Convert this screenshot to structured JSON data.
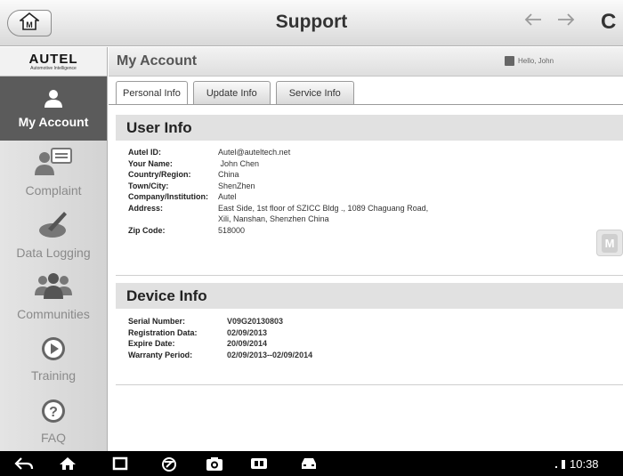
{
  "topbar": {
    "title": "Support",
    "home_icon": "home-icon",
    "back_icon": "arrow-left-icon",
    "forward_icon": "arrow-right-icon",
    "refresh_label": "C"
  },
  "sidebar": {
    "logo_main": "AUTEL",
    "logo_sub": "Automotive Intelligence",
    "items": [
      {
        "label": "My Account",
        "icon": "person-icon",
        "active": true
      },
      {
        "label": "Complaint",
        "icon": "complaint-icon",
        "active": false
      },
      {
        "label": "Data Logging",
        "icon": "data-logging-icon",
        "active": false
      },
      {
        "label": "Communities",
        "icon": "communities-icon",
        "active": false
      },
      {
        "label": "Training",
        "icon": "play-icon",
        "active": false
      },
      {
        "label": "FAQ",
        "icon": "question-icon",
        "active": false
      }
    ]
  },
  "main": {
    "header_title": "My Account",
    "greeting": "Hello, John",
    "tabs": [
      {
        "label": "Personal Info",
        "active": true
      },
      {
        "label": "Update Info",
        "active": false
      },
      {
        "label": "Service Info",
        "active": false
      }
    ],
    "user_info": {
      "title": "User Info",
      "rows": [
        {
          "label": "Autel ID:",
          "value": "Autel@auteltech.net"
        },
        {
          "label": "Your Name:",
          "value": " John Chen"
        },
        {
          "label": "Country/Region:",
          "value": "China"
        },
        {
          "label": "Town/City:",
          "value": "ShenZhen"
        },
        {
          "label": "Company/Institution:",
          "value": "Autel"
        },
        {
          "label": "Address:",
          "value": "East Side, 1st floor of SZICC Bldg ., 1089 Chaguang Road,",
          "value2": "Xili, Nanshan, Shenzhen China"
        },
        {
          "label": "Zip Code:",
          "value": "518000"
        }
      ]
    },
    "device_info": {
      "title": "Device Info",
      "rows": [
        {
          "label": "Serial Number:",
          "value": "V09G20130803"
        },
        {
          "label": "Registration Data:",
          "value": "02/09/2013"
        },
        {
          "label": "Expire Date:",
          "value": "20/09/2014"
        },
        {
          "label": "Warranty Period:",
          "value": "02/09/2013--02/09/2014"
        }
      ]
    },
    "floating_button": "M"
  },
  "system_bar": {
    "time": "10:38",
    "icons": [
      "back-icon",
      "home-icon",
      "recents-icon",
      "browser-icon",
      "camera-icon",
      "vci-icon",
      "car-icon"
    ]
  },
  "colors": {
    "sidebar_active": "#5b5b5b",
    "section_header": "#e1e1e1",
    "system_bar": "#000000"
  }
}
